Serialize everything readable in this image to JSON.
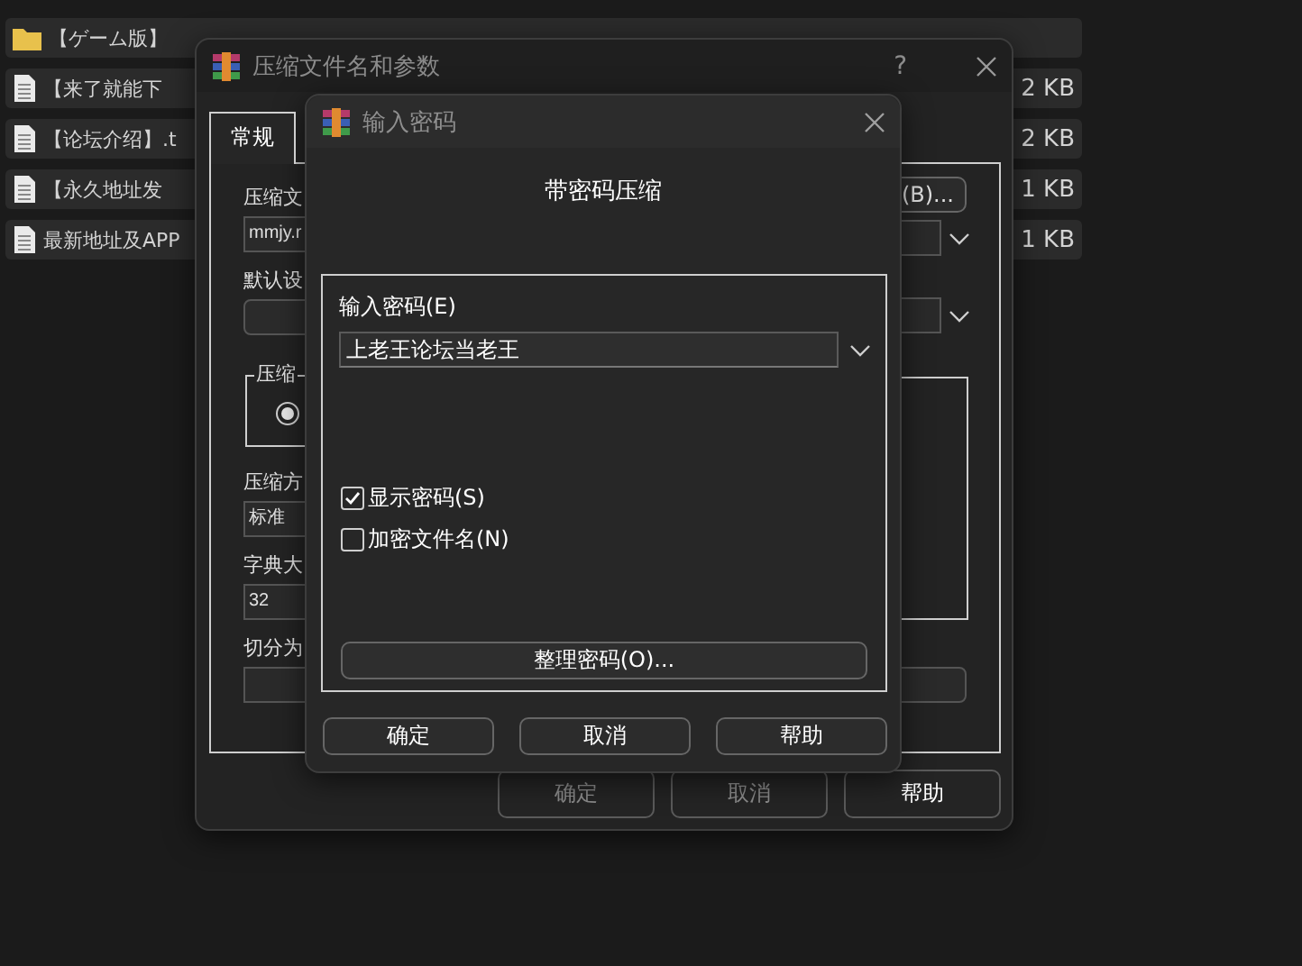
{
  "files": [
    {
      "kind": "folder",
      "name": "【ゲーム版】"
    },
    {
      "kind": "document",
      "name": "【来了就能下",
      "size": "2 KB"
    },
    {
      "kind": "document",
      "name": "【论坛介绍】.t",
      "size": "2 KB"
    },
    {
      "kind": "document",
      "name": "【永久地址发",
      "size": "1 KB"
    },
    {
      "kind": "document",
      "name": "最新地址及APP",
      "size": "1 KB"
    }
  ],
  "main_dialog": {
    "title": "压缩文件名和参数",
    "help": "?",
    "tabs": [
      {
        "label": "常规",
        "selected": true
      }
    ],
    "left_column": [
      {
        "kind": "label",
        "text": "压缩文"
      },
      {
        "kind": "input",
        "value": "mmjy.r"
      },
      {
        "kind": "label",
        "text": "默认设"
      },
      {
        "kind": "button"
      },
      {
        "kind": "group",
        "legend": "压缩",
        "radio": {
          "checked": true
        }
      },
      {
        "kind": "label",
        "text": "压缩方"
      },
      {
        "kind": "input",
        "value": "标准"
      },
      {
        "kind": "label",
        "text": "字典大"
      },
      {
        "kind": "input",
        "value": "32"
      },
      {
        "kind": "label",
        "text": "切分为"
      },
      {
        "kind": "input"
      }
    ],
    "right_column": [
      {
        "kind": "button",
        "label": "(B)..."
      },
      {
        "kind": "combo"
      },
      {
        "kind": "combo"
      },
      {
        "kind": "group"
      },
      {
        "kind": "input"
      }
    ],
    "buttons": [
      {
        "label": "确定",
        "disabled": true
      },
      {
        "label": "取消",
        "disabled": true
      },
      {
        "label": "帮助",
        "disabled": false
      }
    ]
  },
  "password_dialog": {
    "title": "输入密码",
    "heading": "带密码压缩",
    "field_label": "输入密码(E)",
    "password": "上老王论坛当老王",
    "options": [
      {
        "label": "显示密码(S)",
        "checked": true
      },
      {
        "label": "加密文件名(N)",
        "checked": false
      }
    ],
    "organize_button": "整理密码(O)...",
    "buttons": [
      {
        "label": "确定"
      },
      {
        "label": "取消"
      },
      {
        "label": "帮助"
      }
    ]
  }
}
